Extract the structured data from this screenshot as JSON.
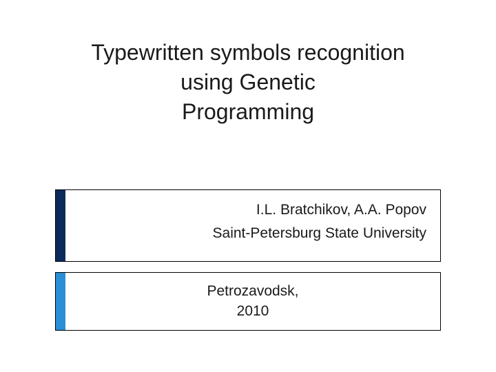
{
  "title": {
    "line1": "Typewritten symbols recognition",
    "line2": "using Genetic",
    "line3": "Programming"
  },
  "authors_box": {
    "authors": "I.L. Bratchikov, A.A. Popov",
    "affiliation": "Saint-Petersburg State University",
    "accent_color": "#0b2a5c"
  },
  "venue_box": {
    "location": "Petrozavodsk,",
    "year": "2010",
    "accent_color": "#2a8fd6"
  }
}
